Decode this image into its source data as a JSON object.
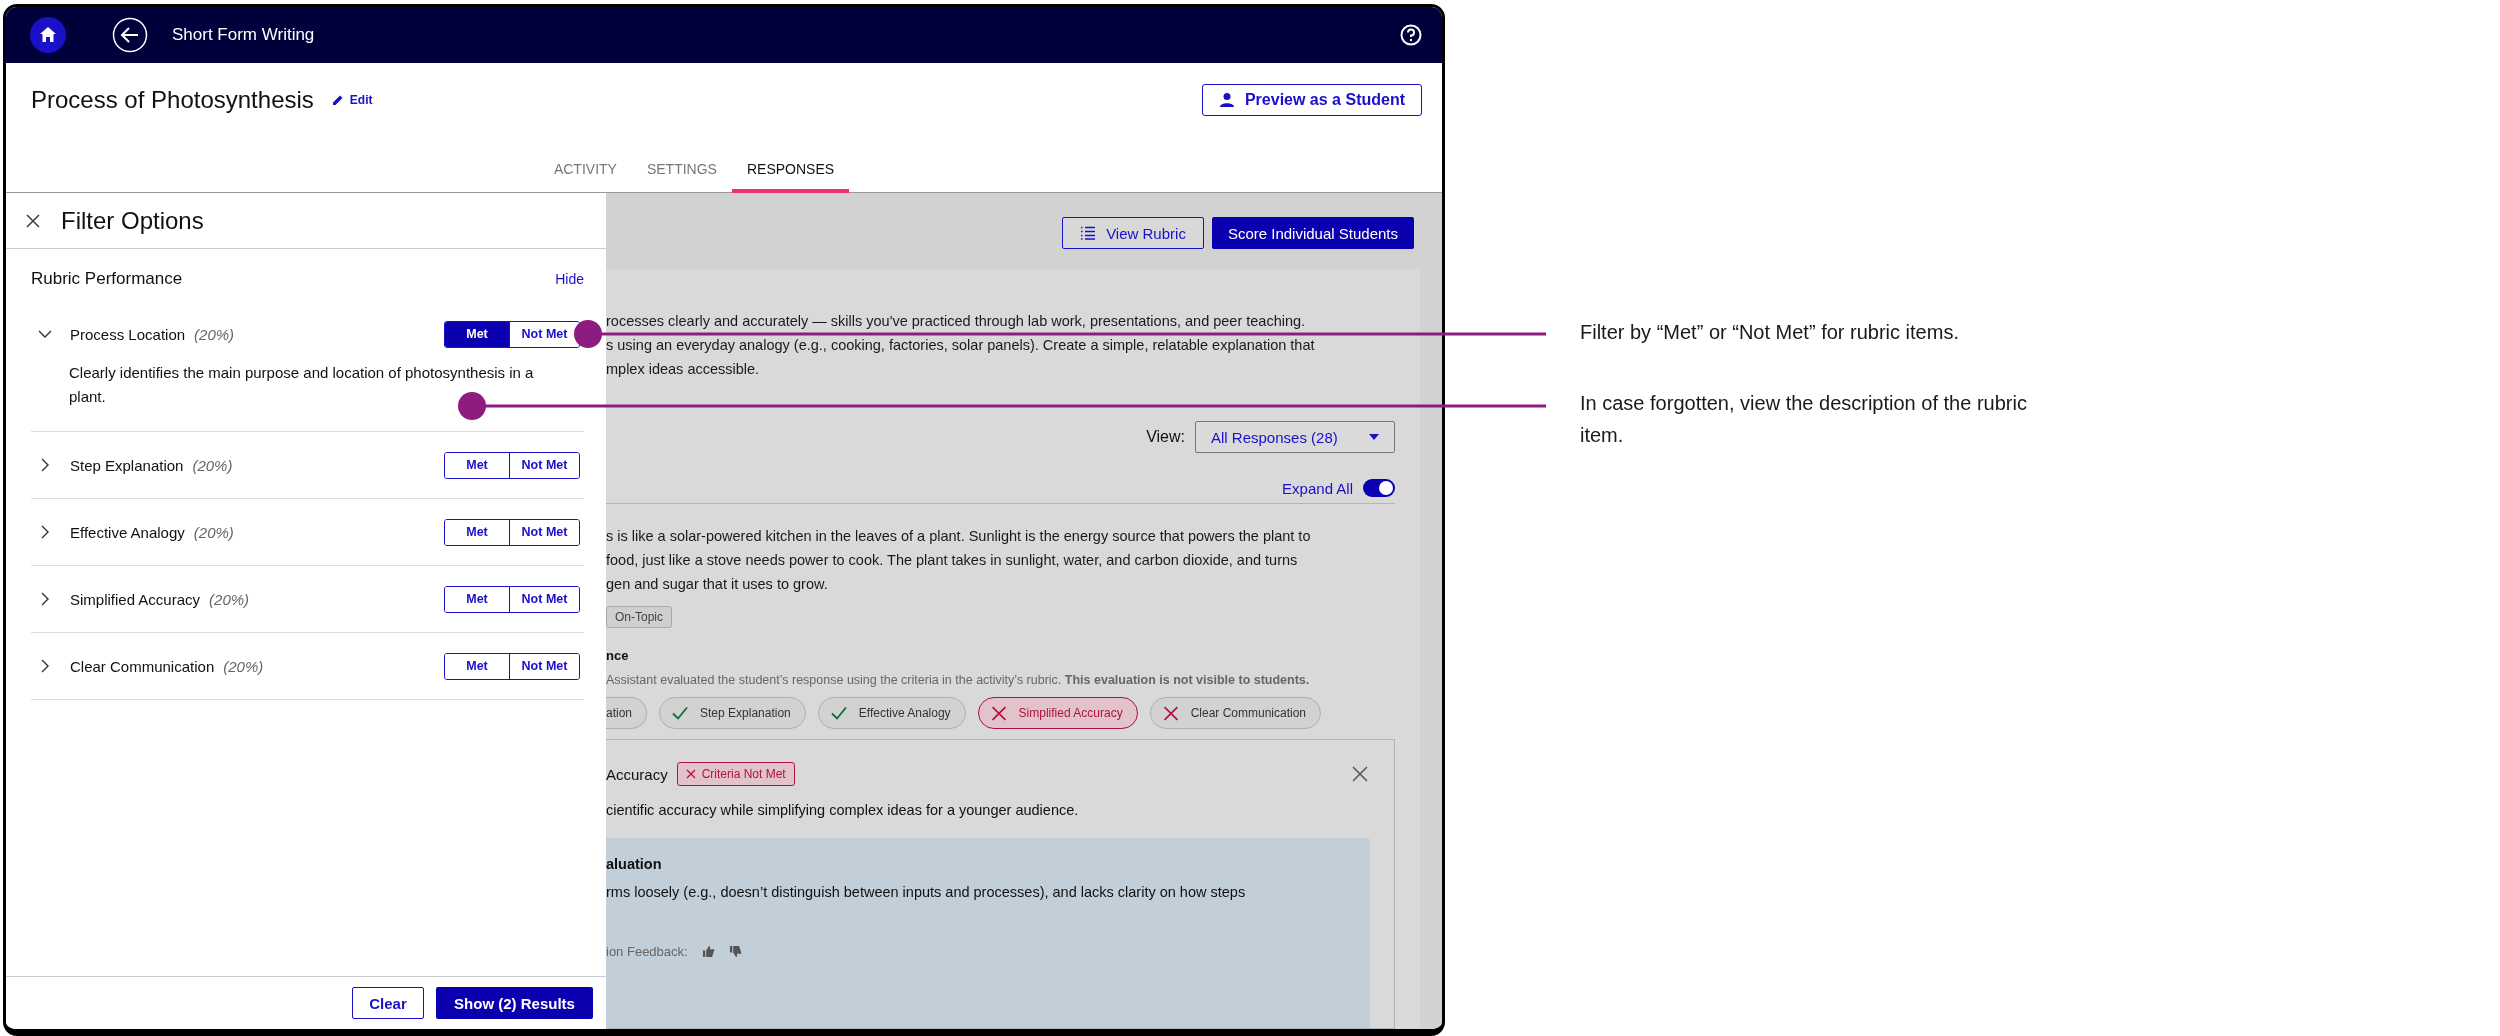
{
  "app_bar": {
    "title": "Short Form Writing"
  },
  "header": {
    "title": "Process of Photosynthesis",
    "edit_label": "Edit",
    "preview_button": "Preview as a Student"
  },
  "tabs": [
    {
      "label": "ACTIVITY",
      "selected": false
    },
    {
      "label": "SETTINGS",
      "selected": false
    },
    {
      "label": "RESPONSES",
      "selected": true
    }
  ],
  "filter_panel": {
    "title": "Filter Options",
    "section_title": "Rubric Performance",
    "hide_link": "Hide",
    "items": [
      {
        "name": "Process Location",
        "weight": "(20%)",
        "expanded": true,
        "description": "Clearly identifies the main purpose and location of photosynthesis in a plant.",
        "options": [
          {
            "label": "Met",
            "selected": true
          },
          {
            "label": "Not Met",
            "selected": false
          }
        ]
      },
      {
        "name": "Step Explanation",
        "weight": "(20%)",
        "expanded": false,
        "options": [
          {
            "label": "Met",
            "selected": false
          },
          {
            "label": "Not Met",
            "selected": false
          }
        ]
      },
      {
        "name": "Effective Analogy",
        "weight": "(20%)",
        "expanded": false,
        "options": [
          {
            "label": "Met",
            "selected": false
          },
          {
            "label": "Not Met",
            "selected": false
          }
        ]
      },
      {
        "name": "Simplified Accuracy",
        "weight": "(20%)",
        "expanded": false,
        "options": [
          {
            "label": "Met",
            "selected": false
          },
          {
            "label": "Not Met",
            "selected": false
          }
        ]
      },
      {
        "name": "Clear Communication",
        "weight": "(20%)",
        "expanded": false,
        "options": [
          {
            "label": "Met",
            "selected": false
          },
          {
            "label": "Not Met",
            "selected": false
          }
        ]
      }
    ],
    "clear_button": "Clear",
    "apply_button": "Show (2) Results"
  },
  "responses": {
    "view_rubric_button": "View Rubric",
    "score_button": "Score Individual Students",
    "prompt_lines": [
      "rocesses clearly and accurately — skills you've practiced through lab work, presentations, and peer teaching.",
      "s using an everyday analogy (e.g., cooking, factories, solar panels). Create a simple, relatable explanation that",
      "mplex ideas accessible."
    ],
    "view_label": "View:",
    "view_value": "All Responses (28)",
    "expand_all_label": "Expand All",
    "expand_all_on": true,
    "response_lines": [
      "s is like a solar-powered kitchen in the leaves of a plant. Sunlight is the energy source that powers the plant to",
      "food, just like a stove needs power to cook. The plant takes in sunlight, water, and carbon dioxide, and turns",
      "gen and sugar that it uses to grow."
    ],
    "tag": "On-Topic",
    "evaluation_heading": "nce",
    "evaluation_note": "Assistant evaluated the student’s response using the criteria in the activity’s rubric. **This evaluation is not visible to students.**",
    "criteria_chips": [
      {
        "label": "ation",
        "selected": false
      },
      {
        "label": "Step Explanation",
        "met": true,
        "selected": false
      },
      {
        "label": "Effective Analogy",
        "met": true,
        "selected": false
      },
      {
        "label": "Simplified Accuracy",
        "met": false,
        "selected": true
      },
      {
        "label": "Clear Communication",
        "met": false,
        "selected": false
      }
    ],
    "detail": {
      "title": "Accuracy",
      "badge": "Criteria Not Met",
      "description": "cientific accuracy while simplifying complex ideas for a younger audience.",
      "eval_heading": "aluation",
      "eval_text": "rms loosely (e.g., doesn’t distinguish between inputs and processes), and lacks clarity on how steps",
      "feedback_label": "ion Feedback:"
    }
  },
  "callouts": [
    {
      "text": "Filter by “Met” or “Not Met” for rubric items."
    },
    {
      "text": "In case forgotten, view the description of the rubric item."
    }
  ]
}
